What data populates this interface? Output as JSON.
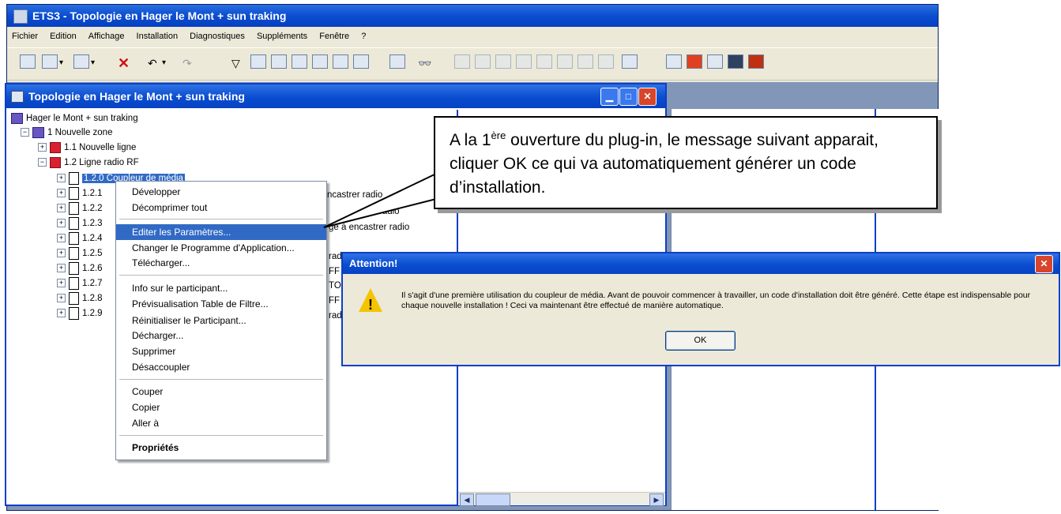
{
  "app": {
    "title": "ETS3 - Topologie en Hager le Mont + sun traking"
  },
  "menu": [
    "Fichier",
    "Edition",
    "Affichage",
    "Installation",
    "Diagnostiques",
    "Suppléments",
    "Fenêtre",
    "?"
  ],
  "child_window": {
    "title": "Topologie en Hager le Mont + sun traking"
  },
  "tree": {
    "root": "Hager le Mont + sun traking",
    "zone": "1 Nouvelle zone",
    "line1": "1.1 Nouvelle ligne",
    "line2": "1.2 Ligne radio RF",
    "devices": [
      "1.2.0",
      "1.2.1",
      "1.2.2",
      "1.2.3",
      "1.2.4",
      "1.2.5",
      "1.2.6",
      "1.2.7",
      "1.2.8",
      "1.2.9"
    ],
    "selected_device_text": "1.2.0 Coupleur de média"
  },
  "right_col_fragments": [
    "ncastrer radio",
    "radio",
    "ge à encastrer radio",
    "rad",
    "FF",
    "TO",
    "FF",
    "rad"
  ],
  "context_menu": {
    "items": [
      "Développer",
      "Décomprimer tout",
      "Editer les Paramètres...",
      "Changer le Programme d'Application...",
      "Télécharger...",
      "Info sur le participant...",
      "Prévisualisation Table de Filtre...",
      "Réinitialiser le Participant...",
      "Décharger...",
      "Supprimer",
      "Désaccoupler",
      "Couper",
      "Copier",
      "Aller à",
      "Propriétés"
    ]
  },
  "callout": {
    "part1": "A la 1",
    "sup": "ère",
    "part2": " ouverture du plug-in, le message suivant apparait, cliquer OK ce qui va automatiquement générer un code d’installation."
  },
  "dialog": {
    "title": "Attention!",
    "message": "Il s'agit d'une première utilisation du coupleur de média. Avant de pouvoir commencer à travailler, un code d'installation doit être généré. Cette étape est indispensable pour chaque nouvelle installation ! Ceci va maintenant être effectué de manière automatique.",
    "ok": "OK",
    "icon": "warning-icon"
  },
  "colors": {
    "titlebar": "#0a4dd0",
    "selection": "#316ac5",
    "warning": "#f5c400",
    "close": "#d8452a"
  }
}
